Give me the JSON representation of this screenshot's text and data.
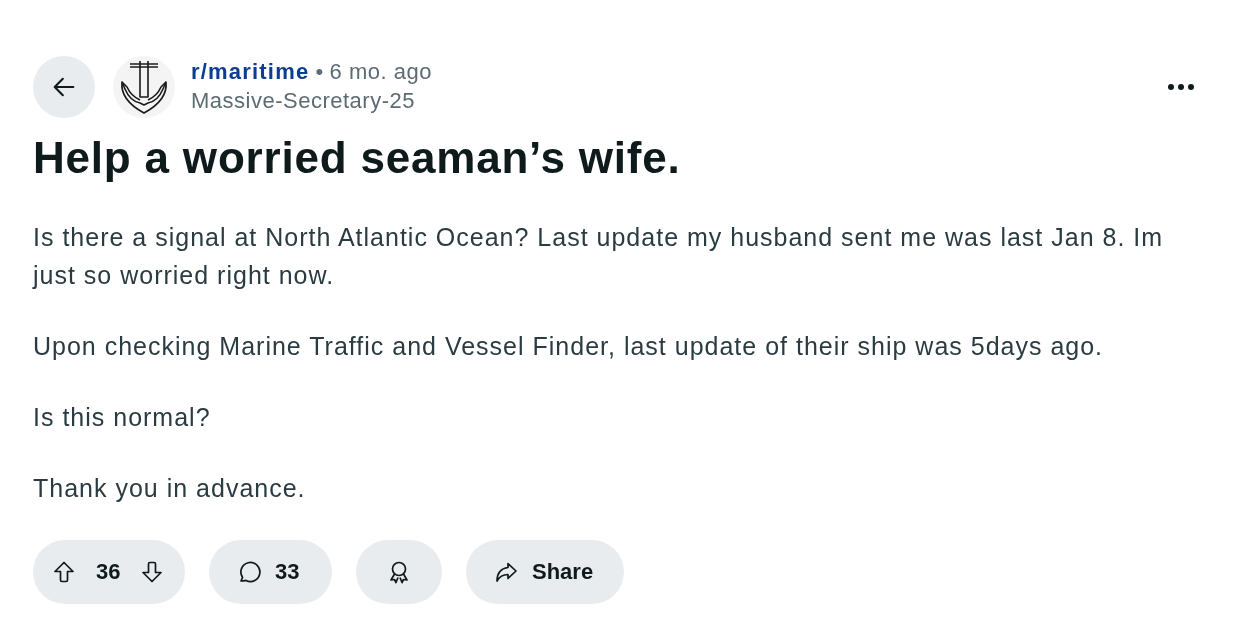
{
  "post": {
    "subreddit": "r/maritime",
    "separator": "•",
    "age": "6 mo. ago",
    "author": "Massive-Secretary-25",
    "title": "Help a worried seaman’s wife.",
    "body": [
      "Is there a signal at North Atlantic Ocean? Last update my husband sent me was last Jan 8. Im just so worried right now.",
      "Upon checking Marine Traffic and Vessel Finder, last update of their ship was 5days ago.",
      "Is this normal?",
      "Thank you in advance."
    ]
  },
  "actions": {
    "score": "36",
    "comments": "33",
    "share": "Share"
  }
}
